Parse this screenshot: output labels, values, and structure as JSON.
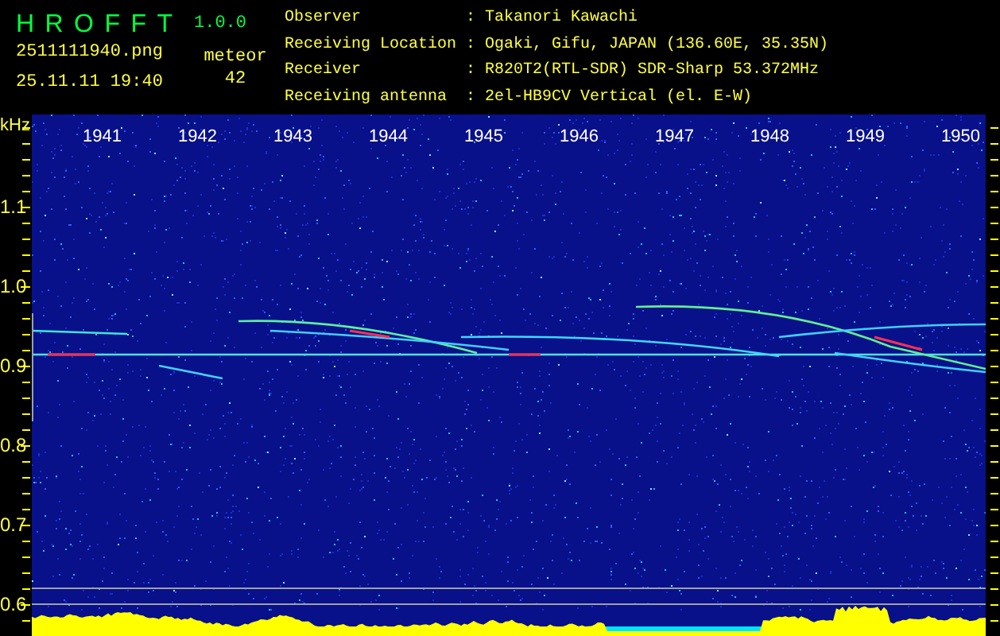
{
  "app": {
    "title": "HROFFT",
    "version": "1.0.0"
  },
  "file": {
    "name": "2511111940.png",
    "datetime": "25.11.11 19:40"
  },
  "meteor": {
    "label": "meteor",
    "count": "42"
  },
  "info": [
    {
      "label": "Observer",
      "separator": ":",
      "value": "Takanori Kawachi"
    },
    {
      "label": "Receiving Location",
      "separator": ":",
      "value": "Ogaki, Gifu, JAPAN (136.60E, 35.35N)"
    },
    {
      "label": "Receiver",
      "separator": ":",
      "value": "R820T2(RTL-SDR) SDR-Sharp 53.372MHz"
    },
    {
      "label": "Receiving antenna",
      "separator": ":",
      "value": "2el-HB9CV Vertical (el. E-W)"
    }
  ],
  "spectrogram": {
    "y_unit": "kHz",
    "y_ticks": [
      "1.1",
      "1.0",
      "0.9",
      "0.8",
      "0.7",
      "0.6"
    ],
    "x_ticks": [
      "1941",
      "1942",
      "1943",
      "1944",
      "1945",
      "1946",
      "1947",
      "1948",
      "1949",
      "1950"
    ]
  }
}
